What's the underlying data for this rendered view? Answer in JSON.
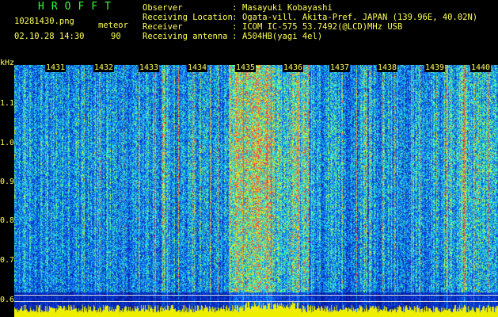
{
  "header": {
    "app_title": "HROFFT",
    "filename": "10281430.png",
    "timestamp": "02.10.28 14:30",
    "mode_label": "meteor",
    "mode_value": "90"
  },
  "metadata": [
    {
      "label": "Observer",
      "value": "Masayuki Kobayashi"
    },
    {
      "label": "Receiving Location",
      "value": "Ogata-vill. Akita-Pref. JAPAN (139.96E, 40.02N)"
    },
    {
      "label": "Receiver",
      "value": "ICOM IC-575 53.7492(@LCD)MHz USB"
    },
    {
      "label": "Receiving antenna",
      "value": "A504HB(yagi 4el)"
    }
  ],
  "spectrogram": {
    "y_unit": "kHz",
    "y_ticks": [
      "1.1",
      "1.0",
      "0.9",
      "0.8",
      "0.7",
      "0.6"
    ],
    "x_ticks": [
      "1431",
      "1432",
      "1433",
      "1434",
      "1435",
      "1436",
      "1437",
      "1438",
      "1439",
      "1440"
    ],
    "colors": {
      "low": "#000080",
      "mid": "#0a78ff",
      "high": "#32ff96",
      "peak": "#ffff00",
      "hot": "#ff3232",
      "text": "#ffff55",
      "title": "#33ff33"
    }
  }
}
